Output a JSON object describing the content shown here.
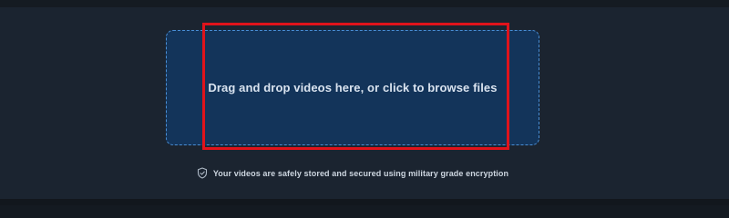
{
  "upload": {
    "dropzone_label": "Drag and drop videos here, or click to browse files",
    "security_note": "Your videos are safely stored and secured using military grade encryption"
  },
  "icons": {
    "security": "shield-check-icon"
  },
  "colors": {
    "page_background": "#1b2430",
    "dropzone_background": "#13345a",
    "dropzone_border": "#4a8fd6",
    "highlight": "#e0131b",
    "text_primary": "#d9e3ef"
  }
}
